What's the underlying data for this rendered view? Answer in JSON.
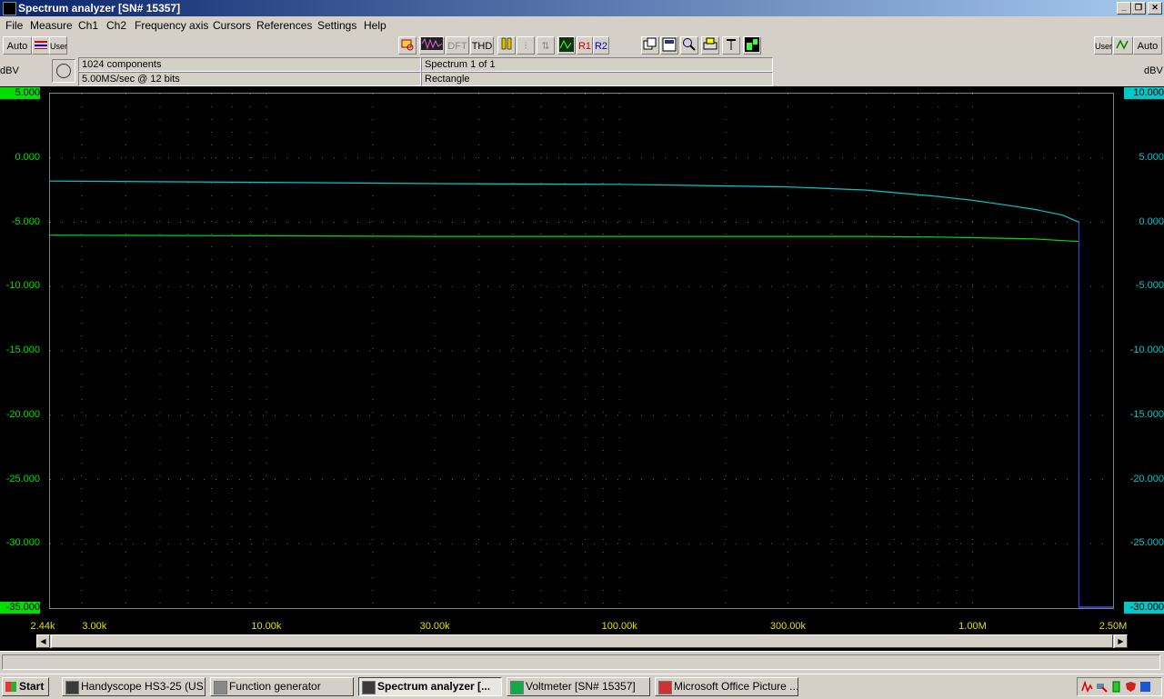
{
  "window": {
    "title": "Spectrum analyzer  [SN# 15357]"
  },
  "menu": [
    "File",
    "Measure",
    "Ch1",
    "Ch2",
    "Frequency axis",
    "Cursors",
    "References",
    "Settings",
    "Help"
  ],
  "toolbar": {
    "auto_left": "Auto",
    "user_left": "User",
    "dft": "DFT",
    "thd": "THD",
    "r1": "R1",
    "r2": "R2",
    "user_right": "User",
    "auto_right": "Auto"
  },
  "info": {
    "components": "1024 components",
    "sample_rate": "5.00MS/sec @ 12 bits",
    "spectrum": "Spectrum 1 of 1",
    "window": "Rectangle"
  },
  "units": {
    "left": "dBV",
    "right": "dBV"
  },
  "colors": {
    "ch1": "#00e000",
    "ch2": "#00c8c8",
    "xaxis": "#e0e000",
    "cursor": "#3050ff"
  },
  "chart_data": {
    "type": "line",
    "x_scale": "log",
    "xlim": [
      2440,
      2500000
    ],
    "x_tick_labels": [
      "2.44k",
      "3.00k",
      "10.00k",
      "30.00k",
      "100.00k",
      "300.00k",
      "1.00M",
      "2.50M"
    ],
    "x_tick_values": [
      2440,
      3000,
      10000,
      30000,
      100000,
      300000,
      1000000,
      2500000
    ],
    "left_axis": {
      "label": "dBV",
      "ylim": [
        -35,
        5
      ],
      "ticks": [
        "5.000",
        "0.000",
        "-5.000",
        "-10.000",
        "-15.000",
        "-20.000",
        "-25.000",
        "-30.000",
        "-35.000"
      ]
    },
    "right_axis": {
      "label": "dBV",
      "ylim": [
        -30,
        10
      ],
      "ticks": [
        "10.000",
        "5.000",
        "0.000",
        "-5.000",
        "-10.000",
        "-15.000",
        "-20.000",
        "-25.000",
        "-30.000"
      ]
    },
    "grid": true,
    "series": [
      {
        "axis": "left",
        "color": "#00e000",
        "x": [
          2440,
          10000,
          30000,
          100000,
          300000,
          500000,
          800000,
          1000000,
          1500000,
          2000000
        ],
        "y": [
          -6.0,
          -6.05,
          -6.1,
          -6.1,
          -6.1,
          -6.1,
          -6.15,
          -6.2,
          -6.3,
          -6.5
        ]
      },
      {
        "axis": "right",
        "color": "#00c8c8",
        "x": [
          2440,
          10000,
          30000,
          100000,
          300000,
          500000,
          800000,
          1000000,
          1200000,
          1500000,
          1800000,
          2000000
        ],
        "y": [
          3.2,
          3.1,
          3.0,
          2.95,
          2.75,
          2.5,
          2.0,
          1.7,
          1.4,
          1.0,
          0.55,
          0.0
        ]
      }
    ],
    "cursor_x": 2000000
  },
  "taskbar": {
    "start": "Start",
    "items": [
      "Handyscope HS3-25 (US...",
      "Function generator",
      "Spectrum analyzer  [...",
      "Voltmeter  [SN# 15357]",
      "Microsoft Office Picture ..."
    ]
  }
}
